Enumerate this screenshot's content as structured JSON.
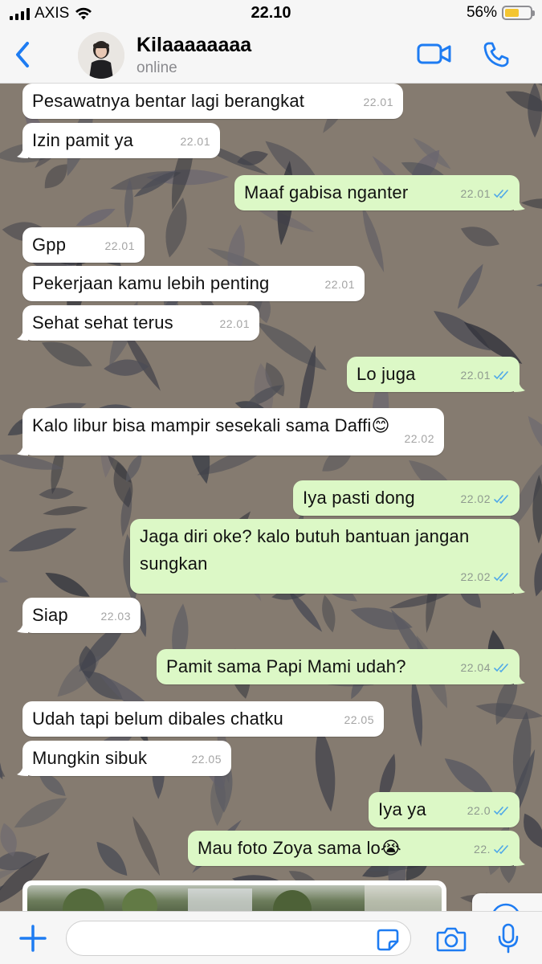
{
  "status_bar": {
    "carrier": "AXIS",
    "time": "22.10",
    "battery": "56%",
    "battery_level": 0.56
  },
  "header": {
    "name": "Kilaaaaaaaa",
    "status": "online"
  },
  "messages": [
    {
      "dir": "in",
      "text": "Pesawatnya bentar lagi berangkat",
      "time": "22.01"
    },
    {
      "dir": "in",
      "text": "Izin pamit ya",
      "time": "22.01"
    },
    {
      "dir": "out",
      "text": "Maaf gabisa nganter",
      "time": "22.01"
    },
    {
      "dir": "in",
      "text": "Gpp",
      "time": "22.01"
    },
    {
      "dir": "in",
      "text": "Pekerjaan kamu lebih penting",
      "time": "22.01"
    },
    {
      "dir": "in",
      "text": "Sehat sehat terus",
      "time": "22.01"
    },
    {
      "dir": "out",
      "text": "Lo juga",
      "time": "22.01"
    },
    {
      "dir": "in",
      "text": "Kalo libur bisa mampir sesekali sama Daffi😊",
      "time": "22.02"
    },
    {
      "dir": "out",
      "text": "Iya pasti dong",
      "time": "22.02"
    },
    {
      "dir": "out",
      "text": "Jaga diri oke? kalo butuh bantuan jangan\nsungkan",
      "time": "22.02"
    },
    {
      "dir": "in",
      "text": "Siap",
      "time": "22.03"
    },
    {
      "dir": "out",
      "text": "Pamit sama Papi Mami udah?",
      "time": "22.04"
    },
    {
      "dir": "in",
      "text": "Udah tapi belum dibales chatku",
      "time": "22.05"
    },
    {
      "dir": "in",
      "text": "Mungkin sibuk",
      "time": "22.05"
    },
    {
      "dir": "out",
      "text": "Iya ya",
      "time": "22.0"
    },
    {
      "dir": "out",
      "text": "Mau foto Zoya sama lo😭",
      "time": "22."
    }
  ],
  "icons": {
    "back": "chevron-left-icon",
    "video": "video-camera-icon",
    "call": "phone-icon",
    "scroll": "chevron-down-circle-icon",
    "plus": "plus-icon",
    "sticker": "sticker-icon",
    "camera": "camera-icon",
    "mic": "microphone-icon"
  },
  "colors": {
    "accent": "#1e7cf2",
    "incoming_bubble": "#ffffff",
    "outgoing_bubble": "#dcf8c6",
    "read_ticks": "#4fa8e8",
    "wallpaper": "#857b70"
  },
  "input": {
    "value": "",
    "placeholder": ""
  }
}
